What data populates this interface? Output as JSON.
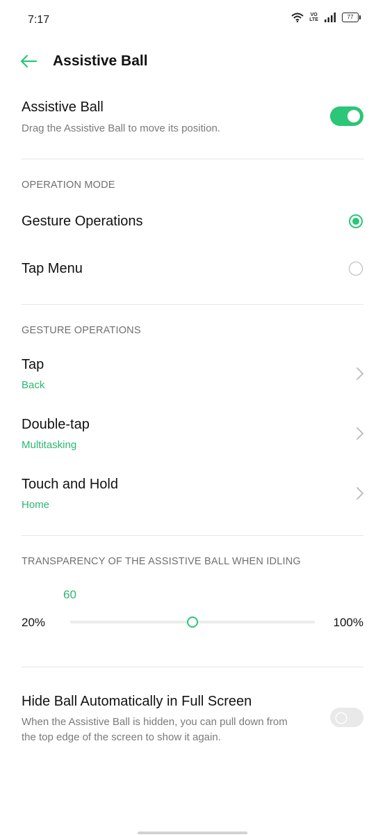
{
  "status_bar": {
    "time": "7:17",
    "battery": "77",
    "network_label": "VoLTE"
  },
  "app_bar": {
    "title": "Assistive Ball",
    "back_icon": "back-arrow-icon"
  },
  "main_toggle": {
    "title": "Assistive Ball",
    "subtitle": "Drag the Assistive Ball to move its position.",
    "enabled": true
  },
  "operation_mode": {
    "header": "OPERATION MODE",
    "options": [
      {
        "label": "Gesture Operations",
        "selected": true
      },
      {
        "label": "Tap Menu",
        "selected": false
      }
    ]
  },
  "gesture_operations": {
    "header": "GESTURE OPERATIONS",
    "items": [
      {
        "label": "Tap",
        "value": "Back"
      },
      {
        "label": "Double-tap",
        "value": "Multitasking"
      },
      {
        "label": "Touch and Hold",
        "value": "Home"
      }
    ]
  },
  "transparency": {
    "header": "TRANSPARENCY OF THE ASSISTIVE BALL WHEN IDLING",
    "value": "60",
    "min_label": "20%",
    "max_label": "100%",
    "min": 20,
    "max": 100,
    "current": 60
  },
  "hide_ball": {
    "title": "Hide Ball Automatically in Full Screen",
    "subtitle_line1": "When the Assistive Ball is hidden, you can pull down from",
    "subtitle_line2": "the top edge of the screen to show it again.",
    "enabled": false
  },
  "colors": {
    "accent": "#2bc677",
    "accent_text": "#2bb673",
    "divider": "#e6e6e6",
    "secondary_text": "#7a7a7a"
  }
}
